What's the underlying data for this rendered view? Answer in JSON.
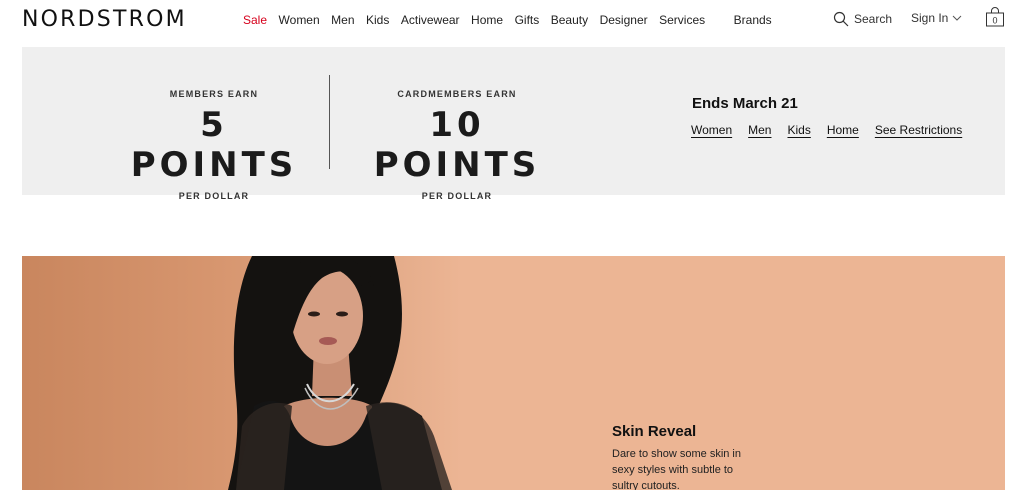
{
  "header": {
    "logo": "NORDSTROM",
    "nav": [
      {
        "label": "Sale"
      },
      {
        "label": "Women"
      },
      {
        "label": "Men"
      },
      {
        "label": "Kids"
      },
      {
        "label": "Activewear"
      },
      {
        "label": "Home"
      },
      {
        "label": "Gifts"
      },
      {
        "label": "Beauty"
      },
      {
        "label": "Designer"
      },
      {
        "label": "Services"
      },
      {
        "label": "Brands"
      }
    ],
    "search_label": "Search",
    "signin_label": "Sign In",
    "bag_count": "0",
    "icons": {
      "search": "search-icon",
      "chevron": "chevron-down-icon",
      "bag": "shopping-bag-icon"
    },
    "sale_color": "#d6001c"
  },
  "promo": {
    "members_label": "MEMBERS EARN",
    "members_points": "5 POINTS",
    "members_per": "PER DOLLAR",
    "cardmembers_label": "CARDMEMBERS EARN",
    "cardmembers_points": "10 POINTS",
    "cardmembers_per": "PER DOLLAR",
    "ends": "Ends March 21",
    "links": [
      {
        "label": "Women"
      },
      {
        "label": "Men"
      },
      {
        "label": "Kids"
      },
      {
        "label": "Home"
      },
      {
        "label": "See Restrictions"
      }
    ],
    "background": "#efefef"
  },
  "hero": {
    "title": "Skin Reveal",
    "copy": "Dare to show some skin in sexy styles with subtle to sultry cutouts.",
    "background": "#ecb594"
  }
}
